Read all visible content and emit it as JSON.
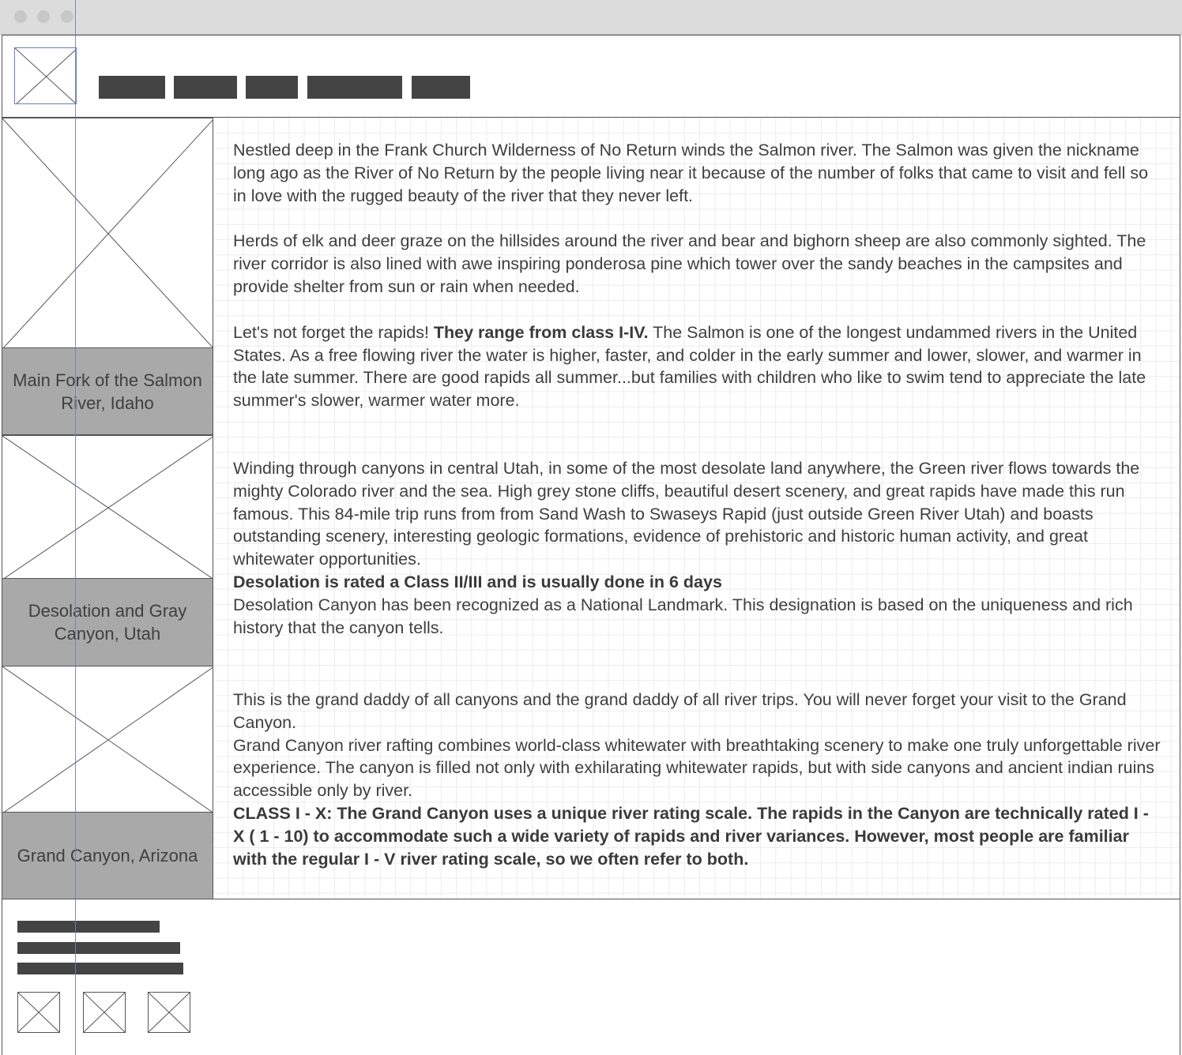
{
  "browser": {
    "window_controls": [
      "close-dot",
      "minimize-dot",
      "maximize-dot"
    ]
  },
  "header": {
    "logo_icon": "image-placeholder-icon",
    "nav_items": [
      "",
      "",
      "",
      "",
      ""
    ]
  },
  "sections": [
    {
      "caption": "Main Fork of the Salmon River, Idaho",
      "image_icon": "image-placeholder-icon",
      "p1": "Nestled deep in the Frank Church Wilderness of No Return winds the Salmon river. The Salmon was given the nickname long ago as the River of No Return by the people living near it because of the number of folks that came to visit and fell so in love with the rugged beauty of the river that they never left.",
      "p2": "Herds of elk and deer graze on the hillsides around the river and bear and bighorn sheep are also commonly sighted. The river corridor is also lined with awe inspiring ponderosa pine which tower over the sandy beaches in the campsites and provide shelter from sun or rain when needed.",
      "p3_pre": "Let's not forget the rapids! ",
      "p3_bold": "They range from class I-IV.",
      "p3_post": " The Salmon is one of the longest undammed rivers in the United States. As a free flowing river the water is higher, faster, and colder in the early summer and lower, slower, and warmer in the late summer. There are good rapids all summer...but families with children who like to swim tend to appreciate the late summer's slower, warmer water more."
    },
    {
      "caption": "Desolation and Gray Canyon, Utah",
      "image_icon": "image-placeholder-icon",
      "p1": "Winding through canyons in central Utah, in some of the most desolate land anywhere, the Green river flows towards the mighty Colorado river and the sea. High grey stone cliffs, beautiful desert scenery, and great rapids have made this run famous. This 84-mile trip runs from from Sand Wash to Swaseys Rapid (just outside Green River Utah) and boasts outstanding scenery, interesting geologic formations, evidence of prehistoric and historic human activity, and great whitewater opportunities.",
      "p2_bold": "Desolation is rated a Class II/III and is usually done in 6 days",
      "p3": "Desolation Canyon has been recognized as a National Landmark. This designation is based on the uniqueness and rich history that the canyon tells."
    },
    {
      "caption": "Grand Canyon, Arizona",
      "image_icon": "image-placeholder-icon",
      "p1": "This is the grand daddy of all canyons and the grand daddy of all river trips. You will never forget your visit to the Grand Canyon.",
      "p2": "Grand Canyon river rafting combines world-class whitewater with breathtaking scenery to make one truly unforgettable river experience. The canyon is filled not only with exhilarating whitewater rapids, but with side canyons and ancient indian ruins accessible only by river.",
      "p3_bold": "CLASS I - X: The Grand Canyon uses a unique river rating scale. The rapids in the Canyon are technically rated I - X ( 1 - 10) to accommodate such a wide variety of rapids and river variances. However, most people are familiar with the regular I - V river rating scale, so we often refer to both."
    }
  ],
  "footer": {
    "text_lines": [
      "",
      "",
      ""
    ],
    "social_icons": [
      "image-placeholder-icon",
      "image-placeholder-icon",
      "image-placeholder-icon"
    ]
  }
}
